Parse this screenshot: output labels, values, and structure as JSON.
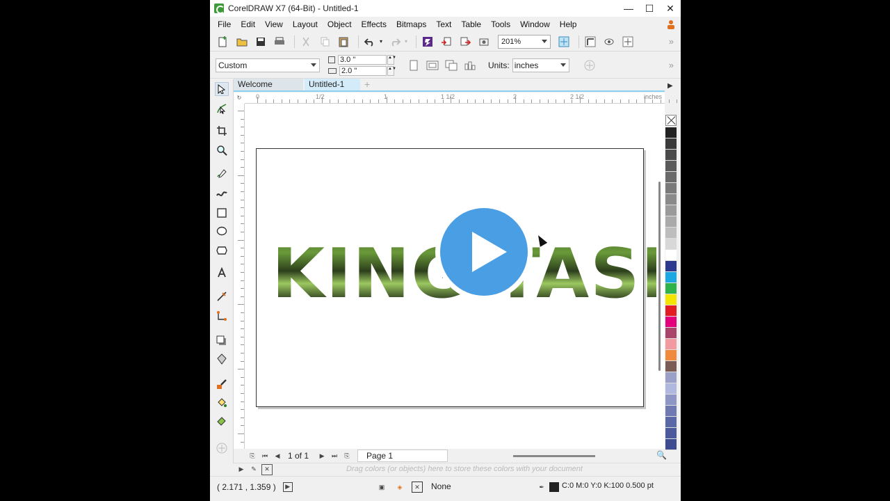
{
  "window": {
    "title": "CorelDRAW X7 (64-Bit) - Untitled-1"
  },
  "menu": [
    "File",
    "Edit",
    "View",
    "Layout",
    "Object",
    "Effects",
    "Bitmaps",
    "Text",
    "Table",
    "Tools",
    "Window",
    "Help"
  ],
  "toolbar": {
    "zoom": "201%"
  },
  "property_bar": {
    "paper_type": "Custom",
    "width": "3.0 \"",
    "height": "2.0 \"",
    "units_label": "Units:",
    "units_value": "inches"
  },
  "tabs": {
    "welcome": "Welcome Screen",
    "document": "Untitled-1"
  },
  "ruler": {
    "h_labels": [
      "0",
      "1/2",
      "1",
      "1 1/2",
      "2",
      "2 1/2",
      "inches"
    ],
    "corner": "↻"
  },
  "canvas": {
    "text": "KING TASH"
  },
  "page_nav": {
    "position": "1 of 1",
    "page_label": "Page 1"
  },
  "doc_palette": {
    "hint": "Drag colors (or objects) here to store these colors with your document"
  },
  "status": {
    "coords": "( 2.171 , 1.359 )",
    "fill": "None",
    "outline": "C:0 M:0 Y:0 K:100  0.500 pt"
  },
  "palette_colors": [
    "#222222",
    "#3a3a3a",
    "#4a4a4a",
    "#5a5a5a",
    "#6a6a6a",
    "#7a7a7a",
    "#8a8a8a",
    "#9a9a9a",
    "#aaaaaa",
    "#bdbdbd",
    "#d8d8d8",
    "#ffffff",
    "#2b3a8f",
    "#1aa7e3",
    "#2db34a",
    "#f4e500",
    "#e31b23",
    "#e4007c",
    "#a9446a",
    "#f19a9f",
    "#f08a3c",
    "#7a5c54",
    "#9aa0c8",
    "#b0b8e0",
    "#8d96c4",
    "#6f7ab3",
    "#5b68a8",
    "#4c5a9d",
    "#3e4d92"
  ],
  "accent_colors": {
    "play": "#4a9ee3",
    "tab_active": "#d4ecf9"
  }
}
